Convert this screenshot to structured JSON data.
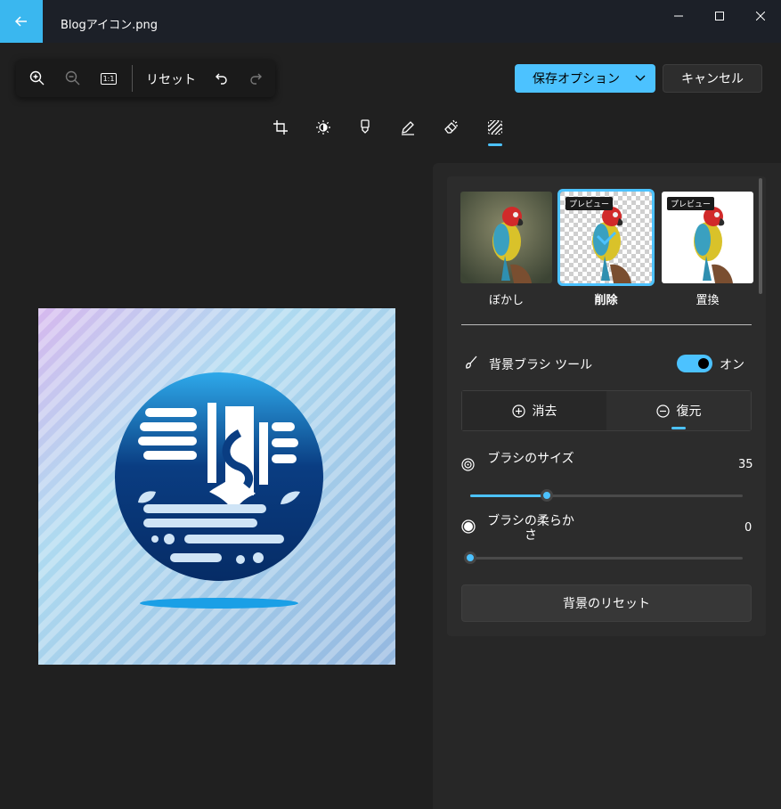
{
  "window": {
    "title": "Blogアイコン.png"
  },
  "toolbar": {
    "reset_label": "リセット",
    "fit_label": "1:1"
  },
  "header": {
    "save_label": "保存オプション",
    "cancel_label": "キャンセル"
  },
  "tools": [
    "crop-icon",
    "brightness-icon",
    "marker-icon",
    "pen-icon",
    "eraser-icon",
    "background-icon"
  ],
  "thumbnails": [
    {
      "label": "ぼかし",
      "badge": ""
    },
    {
      "label": "削除",
      "badge": "プレビュー"
    },
    {
      "label": "置換",
      "badge": "プレビュー"
    }
  ],
  "brush_tool": {
    "label": "背景ブラシ ツール",
    "toggle_label": "オン",
    "on": true
  },
  "modes": {
    "erase_label": "消去",
    "restore_label": "復元",
    "selected": "restore"
  },
  "brush_size": {
    "label": "ブラシのサイズ",
    "value": "35",
    "fraction": 0.28
  },
  "brush_softness": {
    "label": "ブラシの柔らかさ",
    "value": "0",
    "fraction": 0.0
  },
  "reset_background_label": "背景のリセット",
  "colors": {
    "accent": "#4cc2ff",
    "back_button": "#3ab7ef",
    "panel": "#272727"
  }
}
